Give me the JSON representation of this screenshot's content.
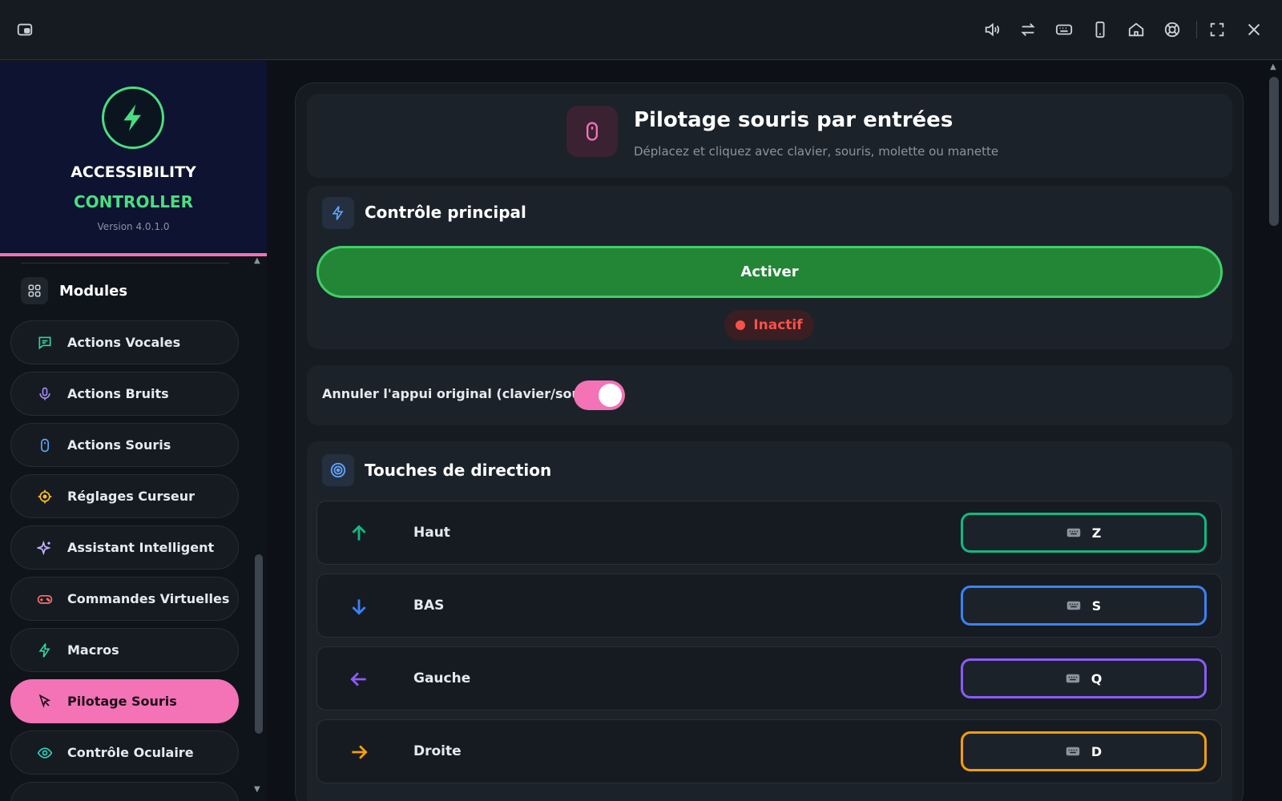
{
  "window": {
    "icons": [
      "pip-icon",
      "volume-icon",
      "swap-icon",
      "keyboard-icon",
      "phone-icon",
      "home-icon",
      "lifebuoy-icon",
      "fullscreen-icon",
      "close-icon"
    ]
  },
  "brand": {
    "line1": "ACCESSIBILITY",
    "line2": "CONTROLLER",
    "version": "Version 4.0.1.0",
    "accent": "#4ade80"
  },
  "sidebar": {
    "section_title": "Modules",
    "items": [
      {
        "label": "Actions Vocales",
        "icon": "chat-icon",
        "color": "#34d399"
      },
      {
        "label": "Actions Bruits",
        "icon": "microphone-icon",
        "color": "#a78bfa"
      },
      {
        "label": "Actions Souris",
        "icon": "mouse-icon",
        "color": "#60a5fa"
      },
      {
        "label": "Réglages Curseur",
        "icon": "crosshair-icon",
        "color": "#fbbf24"
      },
      {
        "label": "Assistant Intelligent",
        "icon": "sparkles-icon",
        "color": "#c4b5fd"
      },
      {
        "label": "Commandes Virtuelles",
        "icon": "gamepad-icon",
        "color": "#f87171"
      },
      {
        "label": "Macros",
        "icon": "lightning-icon",
        "color": "#34d399"
      },
      {
        "label": "Pilotage Souris",
        "icon": "cursor-arrow-icon",
        "color": "#1a0f18",
        "active": true
      },
      {
        "label": "Contrôle Oculaire",
        "icon": "eye-icon",
        "color": "#2dd4bf"
      }
    ]
  },
  "main": {
    "hero": {
      "title": "Pilotage souris par entrées",
      "subtitle": "Déplacez et cliquez avec clavier, souris, molette ou manette"
    },
    "control": {
      "title": "Contrôle principal",
      "button_label": "Activer",
      "status": "Inactif",
      "status_color": "#f85149"
    },
    "toggle": {
      "label": "Annuler l'appui original (clavier/souris)",
      "on": true
    },
    "directions": {
      "title": "Touches de direction",
      "rows": [
        {
          "label": "Haut",
          "key": "Z",
          "arrow": "arrow-up-icon",
          "color": "#10b981"
        },
        {
          "label": "BAS",
          "key": "S",
          "arrow": "arrow-down-icon",
          "color": "#3b82f6"
        },
        {
          "label": "Gauche",
          "key": "Q",
          "arrow": "arrow-left-icon",
          "color": "#8b5cf6"
        },
        {
          "label": "Droite",
          "key": "D",
          "arrow": "arrow-right-icon",
          "color": "#f59e0b"
        }
      ]
    }
  }
}
